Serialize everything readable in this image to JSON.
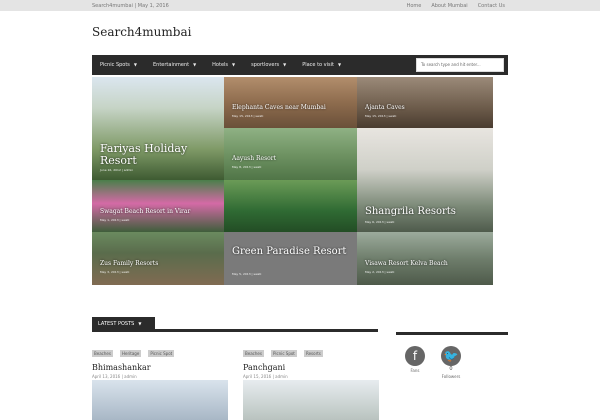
{
  "top": {
    "site_and_date": "Search4mumbai | May 1, 2016",
    "links": [
      "Home",
      "About Mumbai",
      "Contact Us"
    ]
  },
  "site": {
    "title": "Search4mumbai"
  },
  "nav": {
    "items": [
      "Picnic Spots",
      "Entertainment",
      "Hotels",
      "sportlovers",
      "Place to visit"
    ],
    "search_placeholder": "To search type and hit enter..."
  },
  "featured": [
    {
      "title": "Fariyas Holiday Resort",
      "meta": "June 16, 2012 | admin"
    },
    {
      "title": "Elephanta Caves near Mumbai",
      "meta": "May 15, 2013 | swati"
    },
    {
      "title": "Ajanta Caves",
      "meta": "May 15, 2013 | swati"
    },
    {
      "title": "Aayush Resort",
      "meta": "May 8, 2013 | swati"
    },
    {
      "title": "Swagat Beach Resort in Virar",
      "meta": "May 1, 2013 | swati"
    },
    {
      "title": "Green Paradise Resort",
      "meta": "May 5, 2013 | swati"
    },
    {
      "title": "Shangrila Resorts",
      "meta": "May 6, 2013 | swati"
    },
    {
      "title": "Zus Family Resorts",
      "meta": "May 3, 2013 | swati"
    },
    {
      "title": "Visawa Resort Kelva Beach",
      "meta": "May 2, 2013 | swati"
    }
  ],
  "latest": {
    "label": "LATEST POSTS"
  },
  "posts": [
    {
      "tags": [
        "Beaches",
        "Heritage",
        "Picnic Spot"
      ],
      "title": "Bhimashankar",
      "meta": "April 13, 2016 | admin"
    },
    {
      "tags": [
        "Beaches",
        "Picnic Spot",
        "Resorts"
      ],
      "title": "Panchgani",
      "meta": "April 15, 2016 | admin"
    }
  ],
  "social": {
    "fb_label": "Fans",
    "tw_label": "Followers",
    "tw_count": "0"
  },
  "colors": {
    "nav": "#2b2b2b",
    "topbar": "#e4e4e4"
  }
}
